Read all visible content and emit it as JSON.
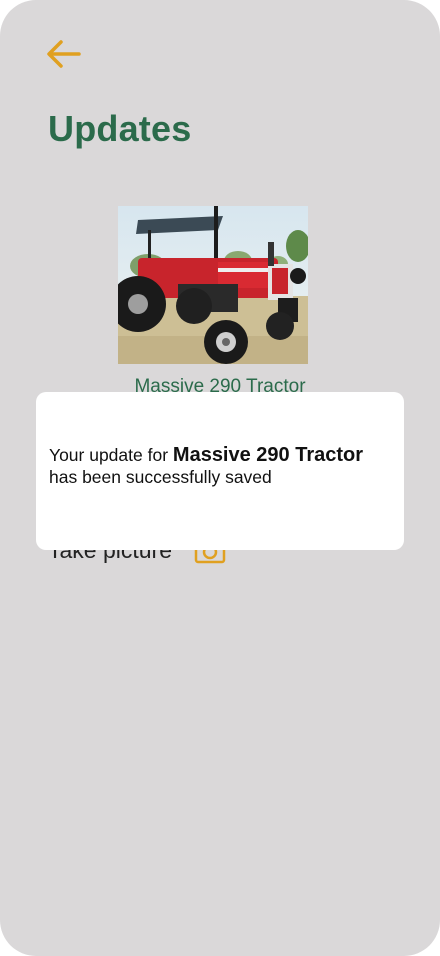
{
  "header": {
    "back_icon": "arrow-left-icon",
    "title": "Updates"
  },
  "product": {
    "name": "Massive 290 Tractor",
    "image": "red-tractor-photo"
  },
  "actions": {
    "take_picture_label": "Take picture",
    "camera_icon": "camera-icon"
  },
  "dialog": {
    "message_prefix": "Your update for ",
    "product_name": "Massive 290 Tractor",
    "message_suffix": "has been successfully saved"
  },
  "colors": {
    "background": "#dad8d9",
    "accent": "#e0a020",
    "title_green": "#2b6b4b",
    "dialog_bg": "#ffffff"
  }
}
